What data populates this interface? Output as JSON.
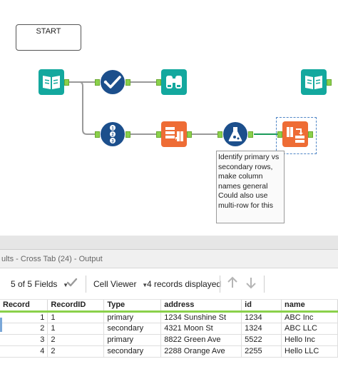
{
  "canvas": {
    "start_comment": "START",
    "annotation_text": "Identify primary vs secondary rows, make column names general Could also use multi-row for this",
    "colors": {
      "input_tool": "#13a89e",
      "browse_tool": "#13a89e",
      "select_tool": "#1c4f8c",
      "record_id_tool": "#1c4f8c",
      "formula_tool": "#1c4f8c",
      "transform_tool": "#ee6c35",
      "anchor": "#8ad14b",
      "wire": "#999999",
      "wire_active": "#1a9a5a"
    },
    "tools": [
      {
        "name": "input-data-tool",
        "icon": "book-icon"
      },
      {
        "name": "select-tool",
        "icon": "checkmark-icon"
      },
      {
        "name": "browse-tool",
        "icon": "binoculars-icon"
      },
      {
        "name": "record-id-tool",
        "icon": "numbered-list-icon"
      },
      {
        "name": "transpose-tool",
        "icon": "transpose-icon"
      },
      {
        "name": "formula-tool",
        "icon": "flask-icon"
      },
      {
        "name": "cross-tab-tool",
        "icon": "cross-tab-icon"
      },
      {
        "name": "input-data-tool-2",
        "icon": "book-icon"
      }
    ]
  },
  "results": {
    "title": "ults - Cross Tab (24) - Output",
    "fields_label": "5 of 5 Fields",
    "viewer_label": "Cell Viewer",
    "records_label": "4 records displayed",
    "columns": [
      "Record",
      "RecordID",
      "Type",
      "address",
      "id",
      "name"
    ],
    "rows": [
      [
        "1",
        "1",
        "primary",
        "1234 Sunshine St",
        "1234",
        "ABC Inc"
      ],
      [
        "2",
        "1",
        "secondary",
        "4321 Moon St",
        "1324",
        "ABC LLC"
      ],
      [
        "3",
        "2",
        "primary",
        "8822 Green Ave",
        "5522",
        "Hello Inc"
      ],
      [
        "4",
        "2",
        "secondary",
        "2288 Orange Ave",
        "2255",
        "Hello LLC"
      ]
    ]
  }
}
